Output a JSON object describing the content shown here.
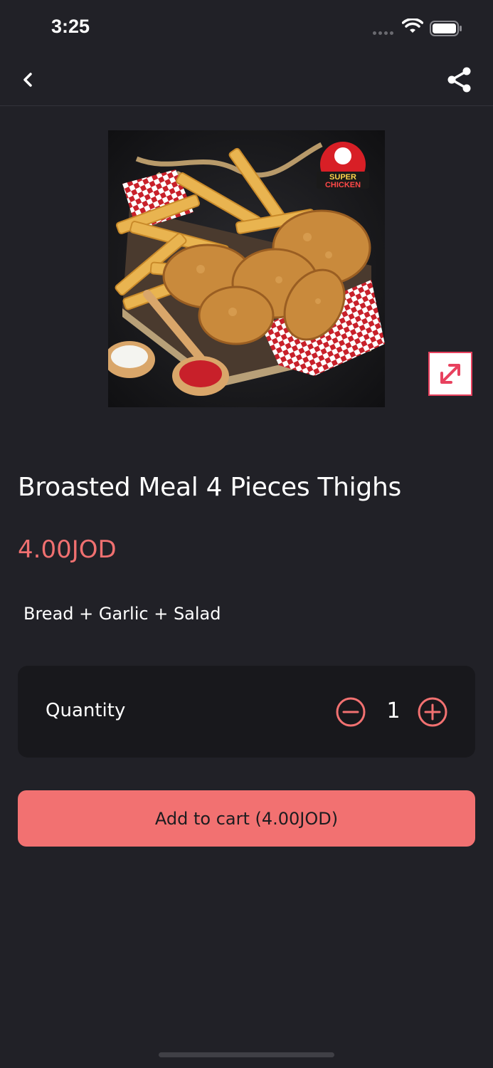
{
  "status_bar": {
    "time": "3:25"
  },
  "nav": {
    "back_icon": "chevron-left-icon",
    "share_icon": "share-icon"
  },
  "product": {
    "image_alt": "Fried chicken with fries",
    "logo_text": [
      "SUPER",
      "CHICKEN"
    ],
    "title": "Broasted Meal 4 Pieces Thighs",
    "price": "4.00JOD",
    "description": "Bread + Garlic + Salad"
  },
  "quantity": {
    "label": "Quantity",
    "value": "1"
  },
  "cart": {
    "button_label": "Add to cart (4.00JOD)"
  },
  "colors": {
    "background": "#212127",
    "accent": "#f27171",
    "card": "#18181c"
  }
}
